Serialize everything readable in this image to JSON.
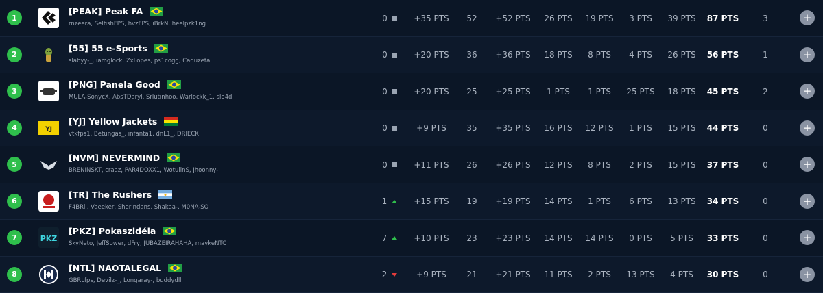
{
  "teams": [
    {
      "pos": "1",
      "tag_name": "[PEAK] Peak FA",
      "flag": "brazil",
      "logo": "peak-logo-icon",
      "players": "rnzeera, SelfishFPS, hvzFPS, iBrkN, heelpzk1ng",
      "movement": "0",
      "trend": "same",
      "c1": "+35 PTS",
      "c2": "52",
      "c3": "+52 PTS",
      "c4": "26 PTS",
      "c5": "19 PTS",
      "c6": "3 PTS",
      "c7": "39 PTS",
      "total": "87 PTS",
      "c9": "3"
    },
    {
      "pos": "2",
      "tag_name": "[55] 55 e-Sports",
      "flag": "brazil",
      "logo": "55-esports-logo-icon",
      "players": "slabyy-_, iamglock, ZxLopes, ps1cogg, Caduzeta",
      "movement": "0",
      "trend": "same",
      "c1": "+20 PTS",
      "c2": "36",
      "c3": "+36 PTS",
      "c4": "18 PTS",
      "c5": "8 PTS",
      "c6": "4 PTS",
      "c7": "26 PTS",
      "total": "56 PTS",
      "c9": "1"
    },
    {
      "pos": "3",
      "tag_name": "[PNG] Panela Good",
      "flag": "brazil",
      "logo": "panela-good-logo-icon",
      "players": "MULA-SonycX, AbsTDaryl, Srlutinhoo, Warlockk_1, slo4d",
      "movement": "0",
      "trend": "same",
      "c1": "+20 PTS",
      "c2": "25",
      "c3": "+25 PTS",
      "c4": "1 PTS",
      "c5": "1 PTS",
      "c6": "25 PTS",
      "c7": "18 PTS",
      "total": "45 PTS",
      "c9": "2"
    },
    {
      "pos": "4",
      "tag_name": "[YJ] Yellow Jackets",
      "flag": "bolivia",
      "logo": "yellow-jackets-logo-icon",
      "players": "vtkfps1, Betungas_, infanta1, dnL1_, DRIECK",
      "movement": "0",
      "trend": "same",
      "c1": "+9 PTS",
      "c2": "35",
      "c3": "+35 PTS",
      "c4": "16 PTS",
      "c5": "12 PTS",
      "c6": "1 PTS",
      "c7": "15 PTS",
      "total": "44 PTS",
      "c9": "0"
    },
    {
      "pos": "5",
      "tag_name": "[NVM] NEVERMIND",
      "flag": "brazil",
      "logo": "nevermind-logo-icon",
      "players": "BRENINSKT, craaz, PAR4DOXX1, WotulinS, Jhoonny-",
      "movement": "0",
      "trend": "same",
      "c1": "+11 PTS",
      "c2": "26",
      "c3": "+26 PTS",
      "c4": "12 PTS",
      "c5": "8 PTS",
      "c6": "2 PTS",
      "c7": "15 PTS",
      "total": "37 PTS",
      "c9": "0"
    },
    {
      "pos": "6",
      "tag_name": "[TR] The Rushers",
      "flag": "argentina",
      "logo": "the-rushers-logo-icon",
      "players": "F4BRii, Vaeeker, Sherindans, Shakaa-, M0NA-SO",
      "movement": "1",
      "trend": "up",
      "c1": "+15 PTS",
      "c2": "19",
      "c3": "+19 PTS",
      "c4": "14 PTS",
      "c5": "1 PTS",
      "c6": "6 PTS",
      "c7": "13 PTS",
      "total": "34 PTS",
      "c9": "0"
    },
    {
      "pos": "7",
      "tag_name": "[PKZ] Pokaszidéia",
      "flag": "brazil",
      "logo": "pokaszideia-logo-icon",
      "players": "SkyNeto, JeffSower, dFry, JUBAZEIRAHAHA, maykeNTC",
      "movement": "7",
      "trend": "up",
      "c1": "+10 PTS",
      "c2": "23",
      "c3": "+23 PTS",
      "c4": "14 PTS",
      "c5": "14 PTS",
      "c6": "0 PTS",
      "c7": "5 PTS",
      "total": "33 PTS",
      "c9": "0"
    },
    {
      "pos": "8",
      "tag_name": "[NTL] NAOTALEGAL",
      "flag": "brazil",
      "logo": "naotalegal-logo-icon",
      "players": "GBRLfps, Devilz-_, Longaray-, buddydll",
      "movement": "2",
      "trend": "down",
      "c1": "+9 PTS",
      "c2": "21",
      "c3": "+21 PTS",
      "c4": "11 PTS",
      "c5": "2 PTS",
      "c6": "13 PTS",
      "c7": "4 PTS",
      "total": "30 PTS",
      "c9": "0"
    }
  ],
  "add_label": "+",
  "colors": {
    "position_badge": "#2fbf4c",
    "trend_up": "#2fbf4c",
    "trend_down": "#e23b3b",
    "background": "#0b1626"
  }
}
